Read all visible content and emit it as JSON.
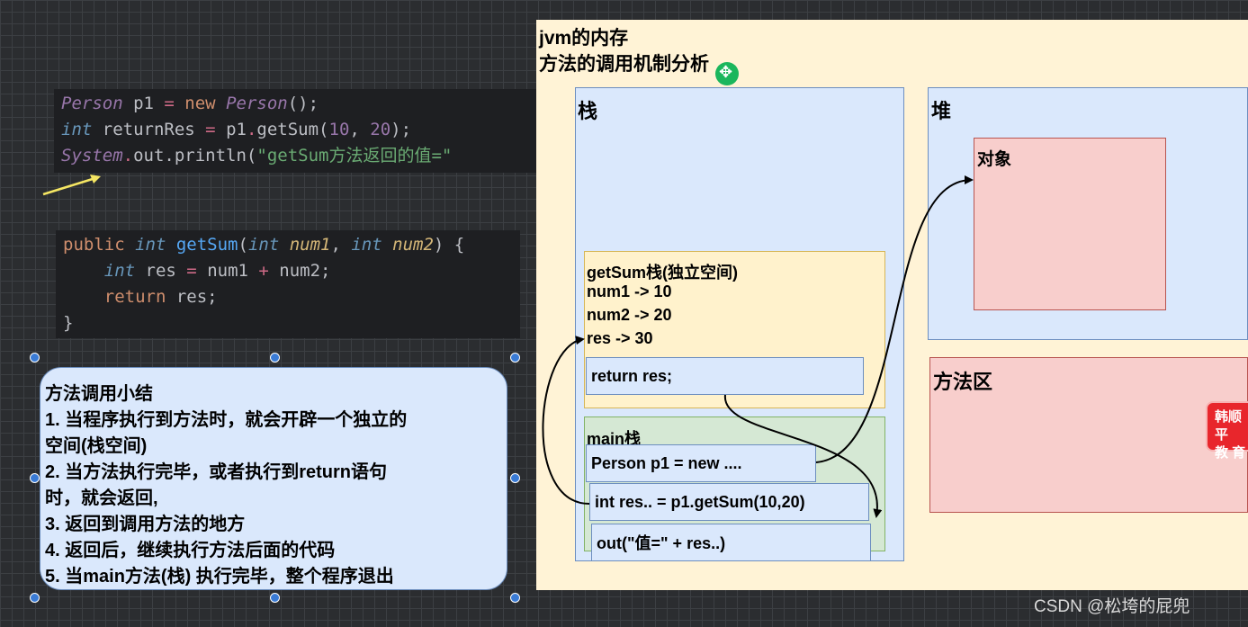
{
  "code_top": {
    "line1": {
      "cls1": "Person",
      "var": " p1 ",
      "eq": "=",
      "kw": " new ",
      "cls2": "Person",
      "tail": "();"
    },
    "line2": {
      "type": "int",
      "var": " returnRes ",
      "eq": "=",
      "obj": " p1",
      "dot": ".",
      "fn": "getSum",
      "open": "(",
      "a": "10",
      "comma": ", ",
      "b": "20",
      "close": ");"
    },
    "line3": {
      "cls": "System",
      "dot": ".",
      "mid": "out.println(",
      "str": "\"getSum方法返回的值=\""
    }
  },
  "code_method": {
    "line1": {
      "kw": "public",
      "type": " int ",
      "fn": "getSum",
      "open": "(",
      "t1": "int",
      "p1": " num1",
      "comma": ", ",
      "t2": "int",
      "p2": " num2",
      "close": ") {"
    },
    "line2": {
      "indent": "    ",
      "type": "int",
      "rest": " res ",
      "eq": "=",
      "a": " num1 ",
      "plus": "+",
      "b": " num2;"
    },
    "line3": {
      "indent": "    ",
      "kw": "return",
      "rest": " res;"
    },
    "line4": "}"
  },
  "diagram": {
    "title_line1": "jvm的内存",
    "title_line2": "方法的调用机制分析",
    "stack_label": "栈",
    "heap_label": "堆",
    "object_label": "对象",
    "method_area_label": "方法区",
    "getsum_frame": {
      "title": "getSum栈(独立空间)",
      "vars": [
        "num1 -> 10",
        "num2 -> 20",
        "res -> 30"
      ],
      "return_stmt": "return res;"
    },
    "main_frame": {
      "title": "main栈",
      "stmts": [
        "Person p1 = new ....",
        "int res.. = p1.getSum(10,20)",
        "out(\"值=\" + res..)"
      ]
    }
  },
  "summary": {
    "title": "方法调用小结",
    "lines": [
      "1. 当程序执行到方法时，就会开辟一个独立的",
      "空间(栈空间)",
      "2. 当方法执行完毕，或者执行到return语句",
      "时，就会返回,",
      "3. 返回到调用方法的地方",
      "4. 返回后，继续执行方法后面的代码",
      "5. 当main方法(栈) 执行完毕，整个程序退出"
    ]
  },
  "badge": {
    "line1": "韩顺平",
    "line2": "教 育"
  },
  "watermark": "CSDN @松垮的屁兜",
  "colors": {
    "arrow": "#000000",
    "pointer": "#f5e663",
    "handle": "#3a7bd5"
  }
}
